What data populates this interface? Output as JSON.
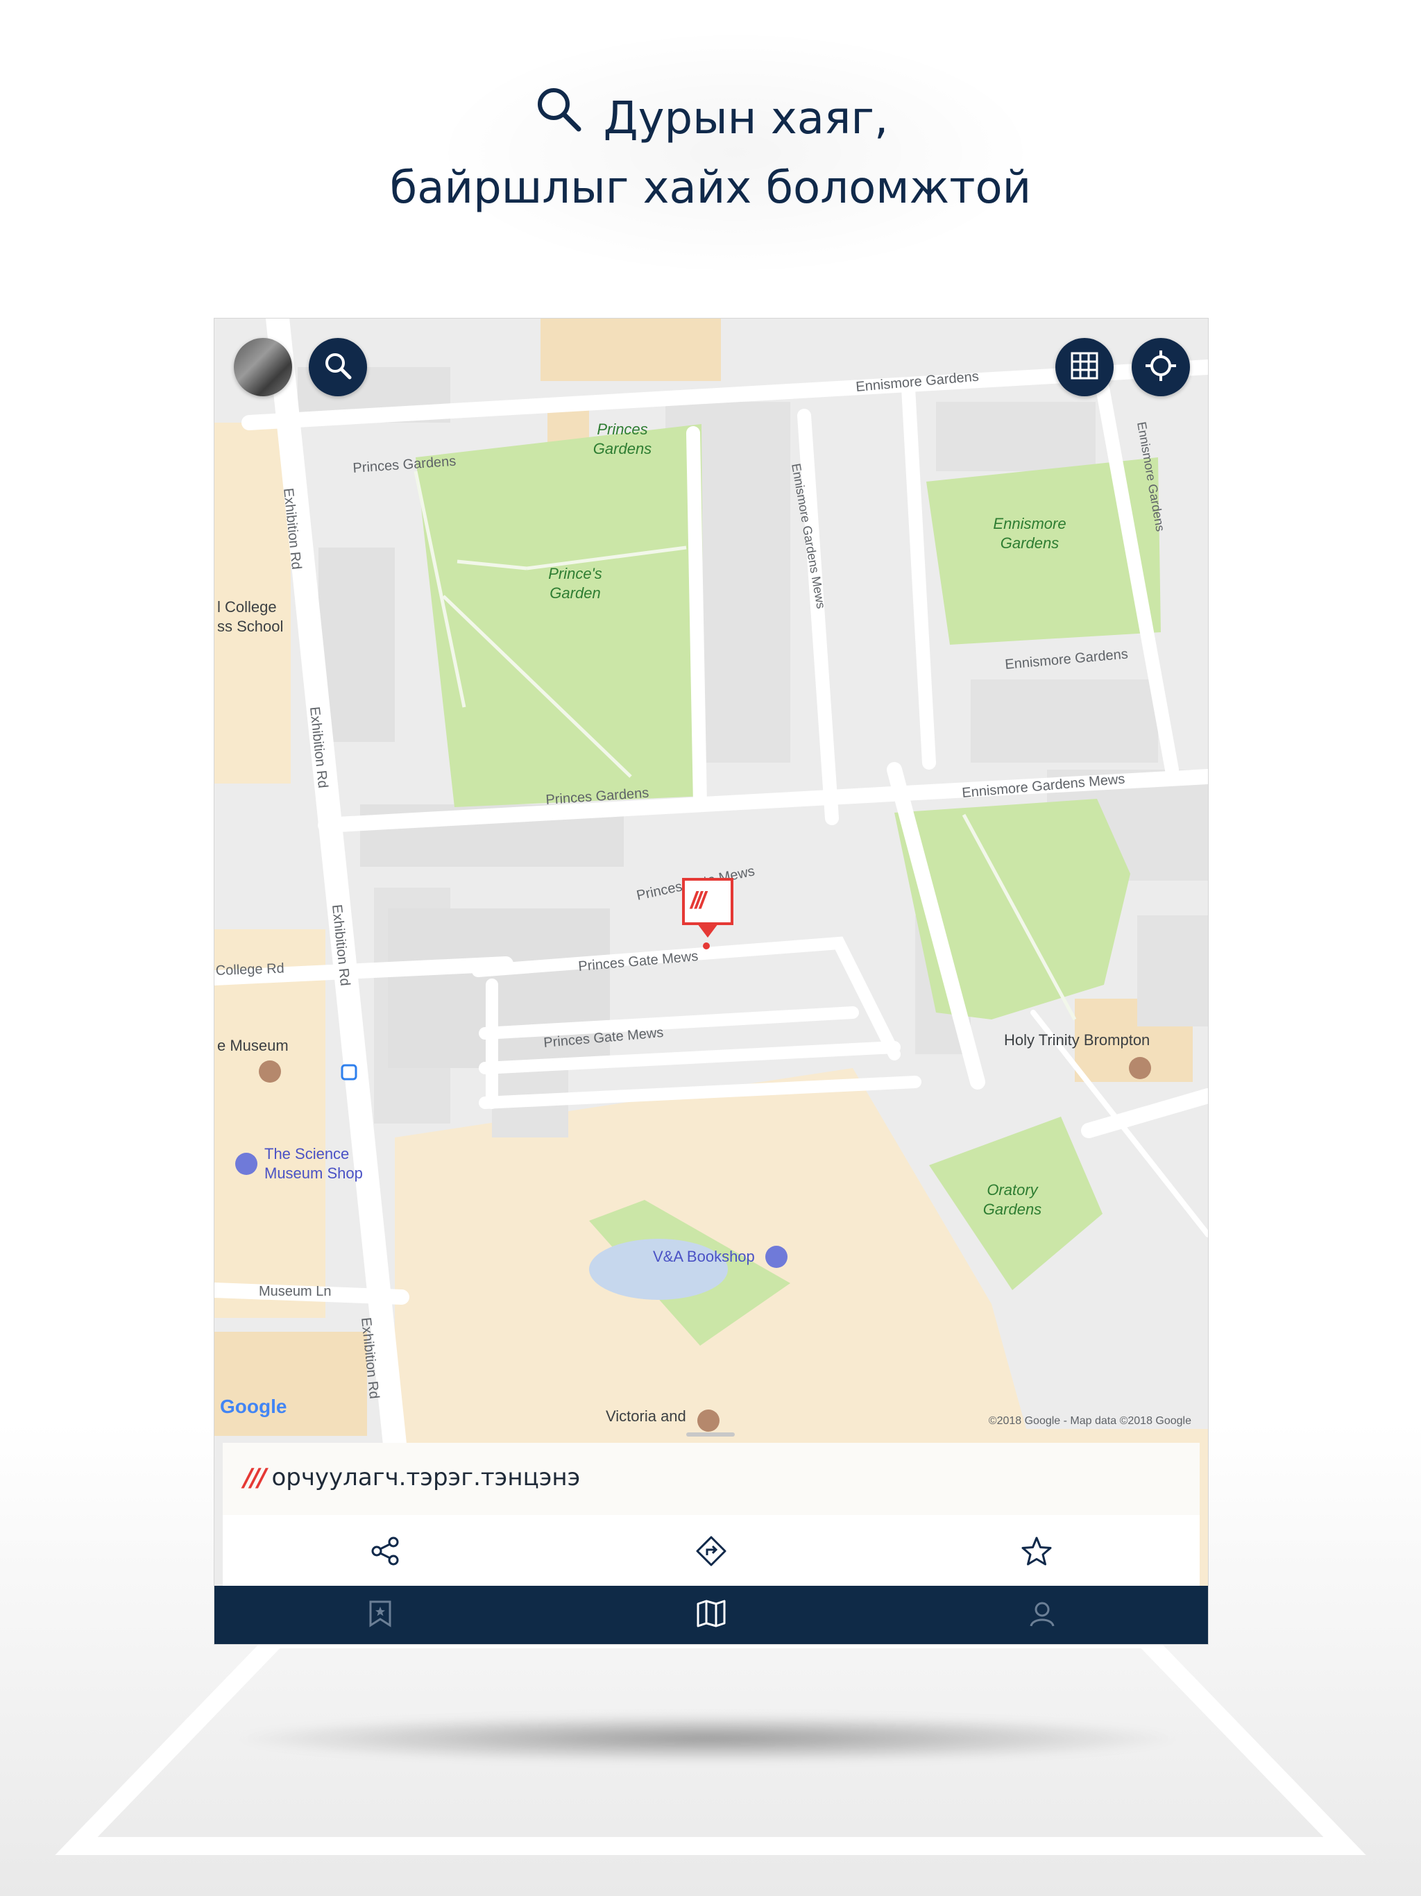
{
  "header": {
    "line1": "Дурын хаяг,",
    "line2": "байршлыг хайх боломжтой"
  },
  "map": {
    "streets": {
      "ennismore_gardens_top": "Ennismore Gardens",
      "princes_gardens_top": "Princes Gardens",
      "exhibition_rd_1": "Exhibition Rd",
      "exhibition_rd_2": "Exhibition Rd",
      "exhibition_rd_3": "Exhibition Rd",
      "exhibition_rd_4": "Exhibition Rd",
      "ennismore_gardens_mews_vertical": "Ennismore Gardens Mews",
      "ennismore_gardens_right": "Ennismore Gardens",
      "ennismore_gardens_mid": "Ennismore Gardens",
      "ennismore_gardens_mews": "Ennismore Gardens Mews",
      "princes_gardens_bottom": "Princes Gardens",
      "princes_gate_mews_1": "Princes Gate Mews",
      "princes_gate_mews_2": "Princes Gate Mews",
      "princes_gate_mews_3": "Princes Gate Mews",
      "college_rd": "College Rd",
      "museum_ln": "Museum Ln"
    },
    "parks": {
      "princes_gardens": "Princes\nGardens",
      "princes_garden": "Prince's\nGarden",
      "ennismore_gardens": "Ennismore\nGardens",
      "oratory_gardens": "Oratory\nGardens"
    },
    "pois": {
      "college": "l College\nss School",
      "museum": "e Museum",
      "science_shop": "The Science\nMuseum Shop",
      "va_bookshop": "V&A Bookshop",
      "holy_trinity": "Holy Trinity Brompton",
      "victoria": "Victoria and"
    },
    "google": "Google",
    "copyright": "©2018 Google - Map data ©2018 Google",
    "marker_logo": "///"
  },
  "card": {
    "logo": "///",
    "title": "орчуулагч.тэрэг.тэнцэнэ"
  },
  "colors": {
    "navy": "#10294a",
    "park": "#c8e6a8",
    "road": "#ffffff",
    "building": "#e4e4e4",
    "beige": "#f9ebcf",
    "brand_red": "#e53935"
  },
  "icons": {
    "top_left": [
      "avatar",
      "search-icon"
    ],
    "top_right": [
      "grid-icon",
      "crosshair-icon"
    ],
    "card_actions": [
      "share-icon",
      "directions-icon",
      "star-icon"
    ],
    "tabs": [
      "bookmark-star-icon",
      "map-icon",
      "user-icon"
    ]
  }
}
